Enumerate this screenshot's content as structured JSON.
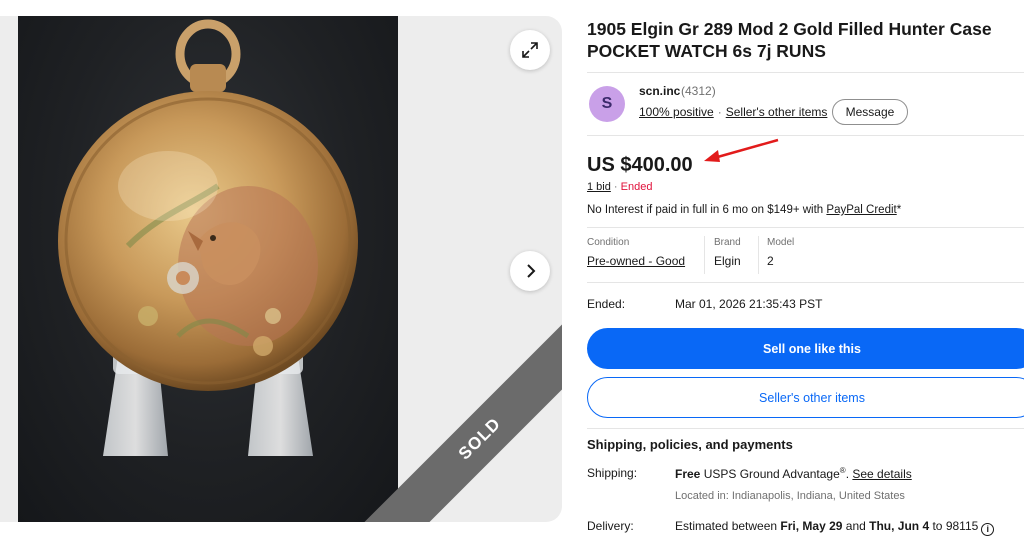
{
  "listing": {
    "title": "1905 Elgin Gr 289 Mod 2 Gold Filled Hunter Case POCKET WATCH 6s 7j RUNS",
    "sold_ribbon": "SOLD"
  },
  "seller": {
    "avatar_letter": "S",
    "avatar_color": "#c9a0e8",
    "name": "scn.inc",
    "feedback_count": "(4312)",
    "positive": "100% positive",
    "other_items_link": "Seller's other items",
    "message_button": "Message"
  },
  "price": {
    "amount": "US $400.00",
    "bid_count": "1 bid",
    "separator": "·",
    "status": "Ended",
    "status_color": "#e0103a"
  },
  "financing": {
    "prefix": "No Interest if paid in full in 6 mo on $149+ with ",
    "link": "PayPal Credit",
    "suffix": "*"
  },
  "item_specifics": [
    {
      "label": "Condition",
      "value": "Pre-owned - Good"
    },
    {
      "label": "Brand",
      "value": "Elgin"
    },
    {
      "label": "Model",
      "value": "2"
    }
  ],
  "ended": {
    "label": "Ended:",
    "value": "Mar 01, 2026 21:35:43 PST"
  },
  "buttons": {
    "sell_one": "Sell one like this",
    "sellers_other_items": "Seller's other items",
    "primary_color": "#0968f6"
  },
  "shipping": {
    "heading": "Shipping, policies, and payments",
    "shipping_label": "Shipping:",
    "shipping_free": "Free",
    "shipping_service": " USPS Ground Advantage",
    "shipping_reg": "®",
    "shipping_dot": ". ",
    "see_details": "See details",
    "location": "Located in: Indianapolis, Indiana, United States",
    "delivery_label": "Delivery:",
    "delivery_prefix": "Estimated between ",
    "delivery_start": "Fri, May 29",
    "delivery_and": " and ",
    "delivery_end": "Thu, Jun 4",
    "delivery_to": " to 98115",
    "info_glyph": "i"
  },
  "icons": {
    "expand": "expand-icon",
    "next": "chevron-right-icon",
    "arrow": "red-arrow-annotation",
    "info": "info-icon"
  }
}
